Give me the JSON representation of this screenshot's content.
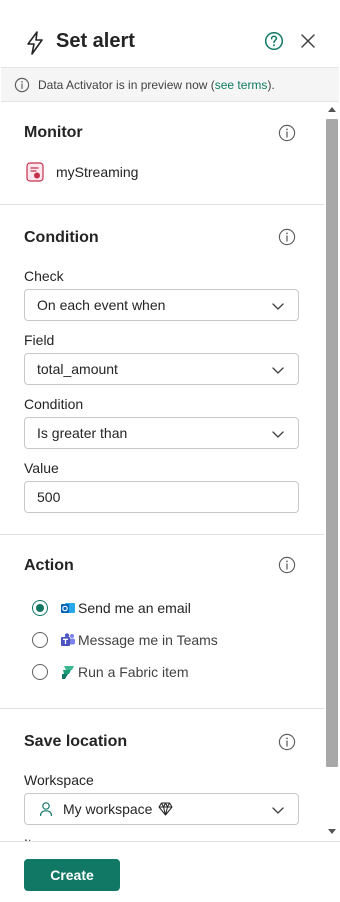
{
  "header": {
    "title": "Set alert"
  },
  "banner": {
    "text": "Data Activator is in preview now (",
    "link": "see terms",
    "suffix": ")."
  },
  "monitor": {
    "title": "Monitor",
    "item": "myStreaming"
  },
  "condition": {
    "title": "Condition",
    "check_label": "Check",
    "check_value": "On each event when",
    "field_label": "Field",
    "field_value": "total_amount",
    "condition_label": "Condition",
    "condition_value": "Is greater than",
    "value_label": "Value",
    "value_value": "500"
  },
  "action": {
    "title": "Action",
    "options": [
      {
        "label": "Send me an email",
        "checked": true
      },
      {
        "label": "Message me in Teams",
        "checked": false
      },
      {
        "label": "Run a Fabric item",
        "checked": false
      }
    ]
  },
  "save_location": {
    "title": "Save location",
    "workspace_label": "Workspace",
    "workspace_value": "My workspace",
    "item_label": "It"
  },
  "footer": {
    "create_label": "Create"
  },
  "colors": {
    "accent": "#117865",
    "link": "#0f7b5f"
  }
}
